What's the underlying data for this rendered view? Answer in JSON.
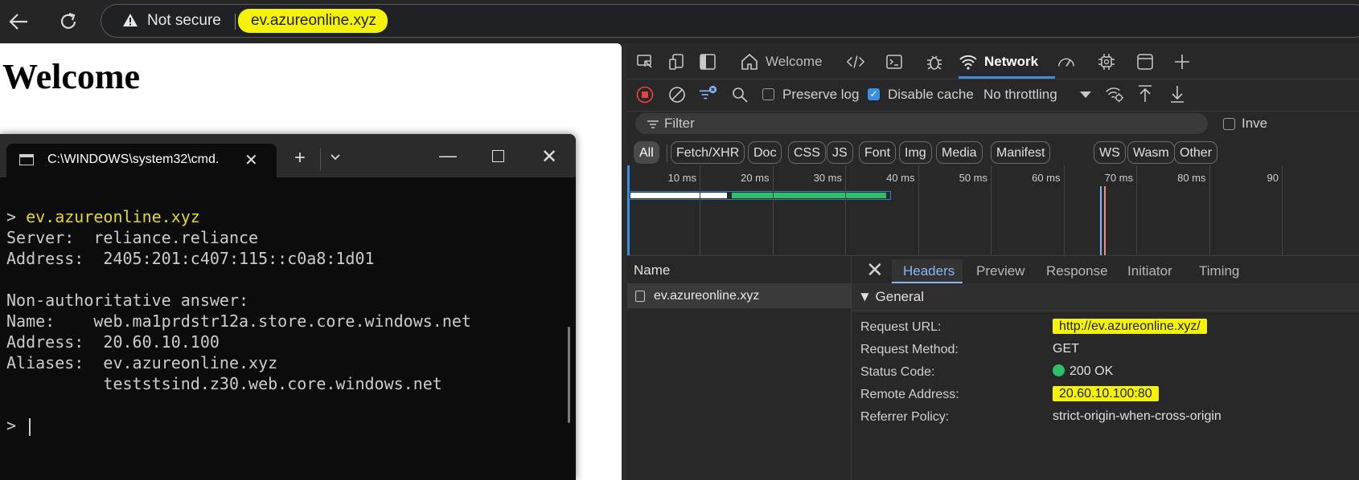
{
  "browser": {
    "security_label": "Not secure",
    "url": "ev.azureonline.xyz"
  },
  "page": {
    "heading": "Welcome"
  },
  "terminal": {
    "tab_title": "C:\\WINDOWS\\system32\\cmd.",
    "lines": [
      {
        "prompt": "> ",
        "text": "ev.azureonline.xyz"
      },
      {
        "text": "Server:  reliance.reliance"
      },
      {
        "text": "Address:  2405:201:c407:115::c0a8:1d01"
      },
      {
        "text": ""
      },
      {
        "text": "Non-authoritative answer:"
      },
      {
        "text": "Name:    web.ma1prdstr12a.store.core.windows.net"
      },
      {
        "text": "Address:  20.60.10.100"
      },
      {
        "text": "Aliases:  ev.azureonline.xyz"
      },
      {
        "text": "          teststsind.z30.web.core.windows.net"
      },
      {
        "text": ""
      },
      {
        "prompt": "> "
      }
    ]
  },
  "devtools": {
    "tabs": {
      "welcome": "Welcome",
      "network": "Network"
    },
    "toolbar": {
      "preserve_log": "Preserve log",
      "disable_cache": "Disable cache",
      "disable_cache_checked": true,
      "preserve_log_checked": false,
      "throttling": "No throttling"
    },
    "filter": {
      "placeholder": "Filter",
      "invert": "Inve"
    },
    "type_filters": [
      "All",
      "Fetch/XHR",
      "Doc",
      "CSS",
      "JS",
      "Font",
      "Img",
      "Media",
      "Manifest",
      "WS",
      "Wasm",
      "Other"
    ],
    "timeline_ticks": [
      "10 ms",
      "20 ms",
      "30 ms",
      "40 ms",
      "50 ms",
      "60 ms",
      "70 ms",
      "80 ms",
      "90"
    ],
    "requests": {
      "column": "Name",
      "rows": [
        "ev.azureonline.xyz"
      ]
    },
    "details": {
      "tabs": [
        "Headers",
        "Preview",
        "Response",
        "Initiator",
        "Timing"
      ],
      "active_tab": "Headers",
      "section": "▼ General",
      "general": [
        {
          "key": "Request URL:",
          "value": "http://ev.azureonline.xyz/"
        },
        {
          "key": "Request Method:",
          "value": "GET"
        },
        {
          "key": "Status Code:",
          "value": "200 OK"
        },
        {
          "key": "Remote Address:",
          "value": "20.60.10.100:80"
        },
        {
          "key": "Referrer Policy:",
          "value": "strict-origin-when-cross-origin"
        }
      ]
    },
    "colors": {
      "accent": "#3a8fe0",
      "highlight": "#f5f209",
      "status_ok": "#2fbf6a"
    }
  }
}
